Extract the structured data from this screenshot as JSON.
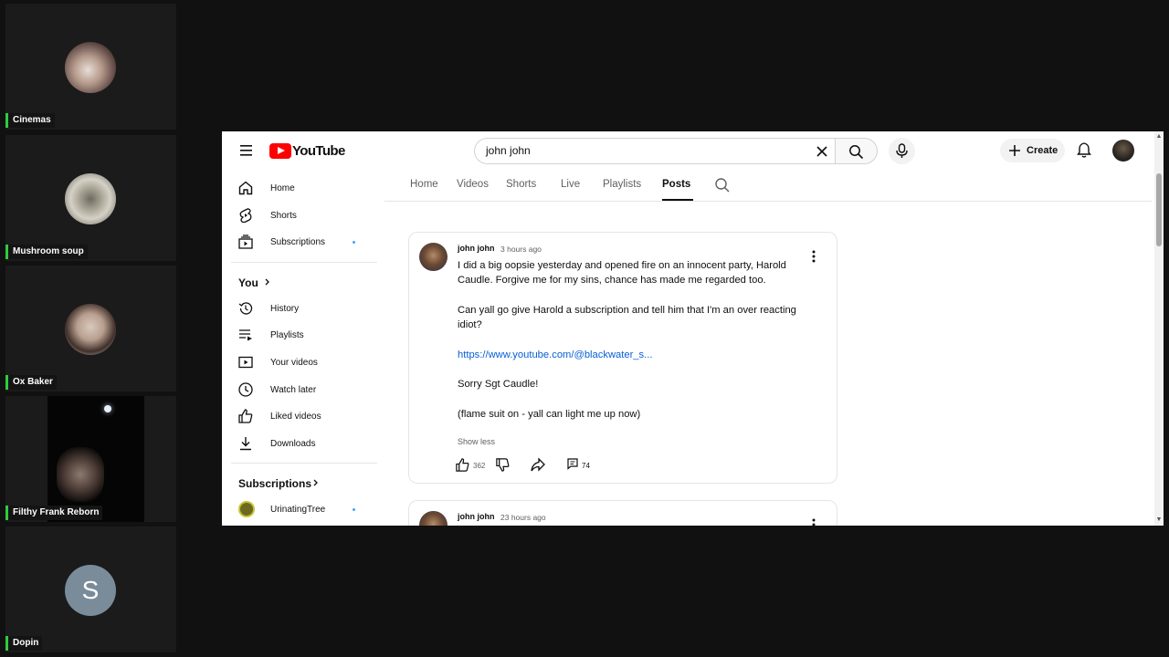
{
  "participants": [
    {
      "name": "Cinemas",
      "kind": "photo-avatar"
    },
    {
      "name": "Mushroom soup",
      "kind": "photo-avatar"
    },
    {
      "name": "Ox Baker",
      "kind": "photo-avatar"
    },
    {
      "name": "Filthy Frank Reborn",
      "kind": "video"
    },
    {
      "name": "Dopin",
      "kind": "letter-avatar",
      "initial": "S"
    }
  ],
  "youtube": {
    "logo_text": "YouTube",
    "search": {
      "query": "john john"
    },
    "create_label": "Create",
    "sidebar": {
      "primary": [
        {
          "label": "Home",
          "icon": "home-icon"
        },
        {
          "label": "Shorts",
          "icon": "shorts-icon"
        },
        {
          "label": "Subscriptions",
          "icon": "subscriptions-icon",
          "new_dot": true
        }
      ],
      "you_heading": "You",
      "you_items": [
        {
          "label": "History",
          "icon": "history-icon"
        },
        {
          "label": "Playlists",
          "icon": "playlists-icon"
        },
        {
          "label": "Your videos",
          "icon": "your-videos-icon"
        },
        {
          "label": "Watch later",
          "icon": "watch-later-icon"
        },
        {
          "label": "Liked videos",
          "icon": "liked-videos-icon"
        },
        {
          "label": "Downloads",
          "icon": "downloads-icon"
        }
      ],
      "subscriptions_heading": "Subscriptions",
      "subscriptions": [
        {
          "label": "UrinatingTree",
          "new_dot": true
        }
      ]
    },
    "tabs": [
      "Home",
      "Videos",
      "Shorts",
      "Live",
      "Playlists",
      "Posts"
    ],
    "active_tab": "Posts",
    "posts": [
      {
        "author": "john john",
        "time": "3 hours ago",
        "paragraphs": [
          "I did a big oopsie yesterday and opened fire on an innocent party, Harold Caudle.  Forgive me for my sins, chance has made me regarded too.",
          "Can yall go give Harold a subscription and tell him that I'm an over reacting idiot?",
          "https://www.youtube.com/@blackwater_s...",
          "Sorry Sgt Caudle!",
          "(flame suit on - yall can light me up now)"
        ],
        "show_less": "Show less",
        "likes": "362",
        "comments": "74"
      },
      {
        "author": "john john",
        "time": "23 hours ago"
      }
    ]
  }
}
